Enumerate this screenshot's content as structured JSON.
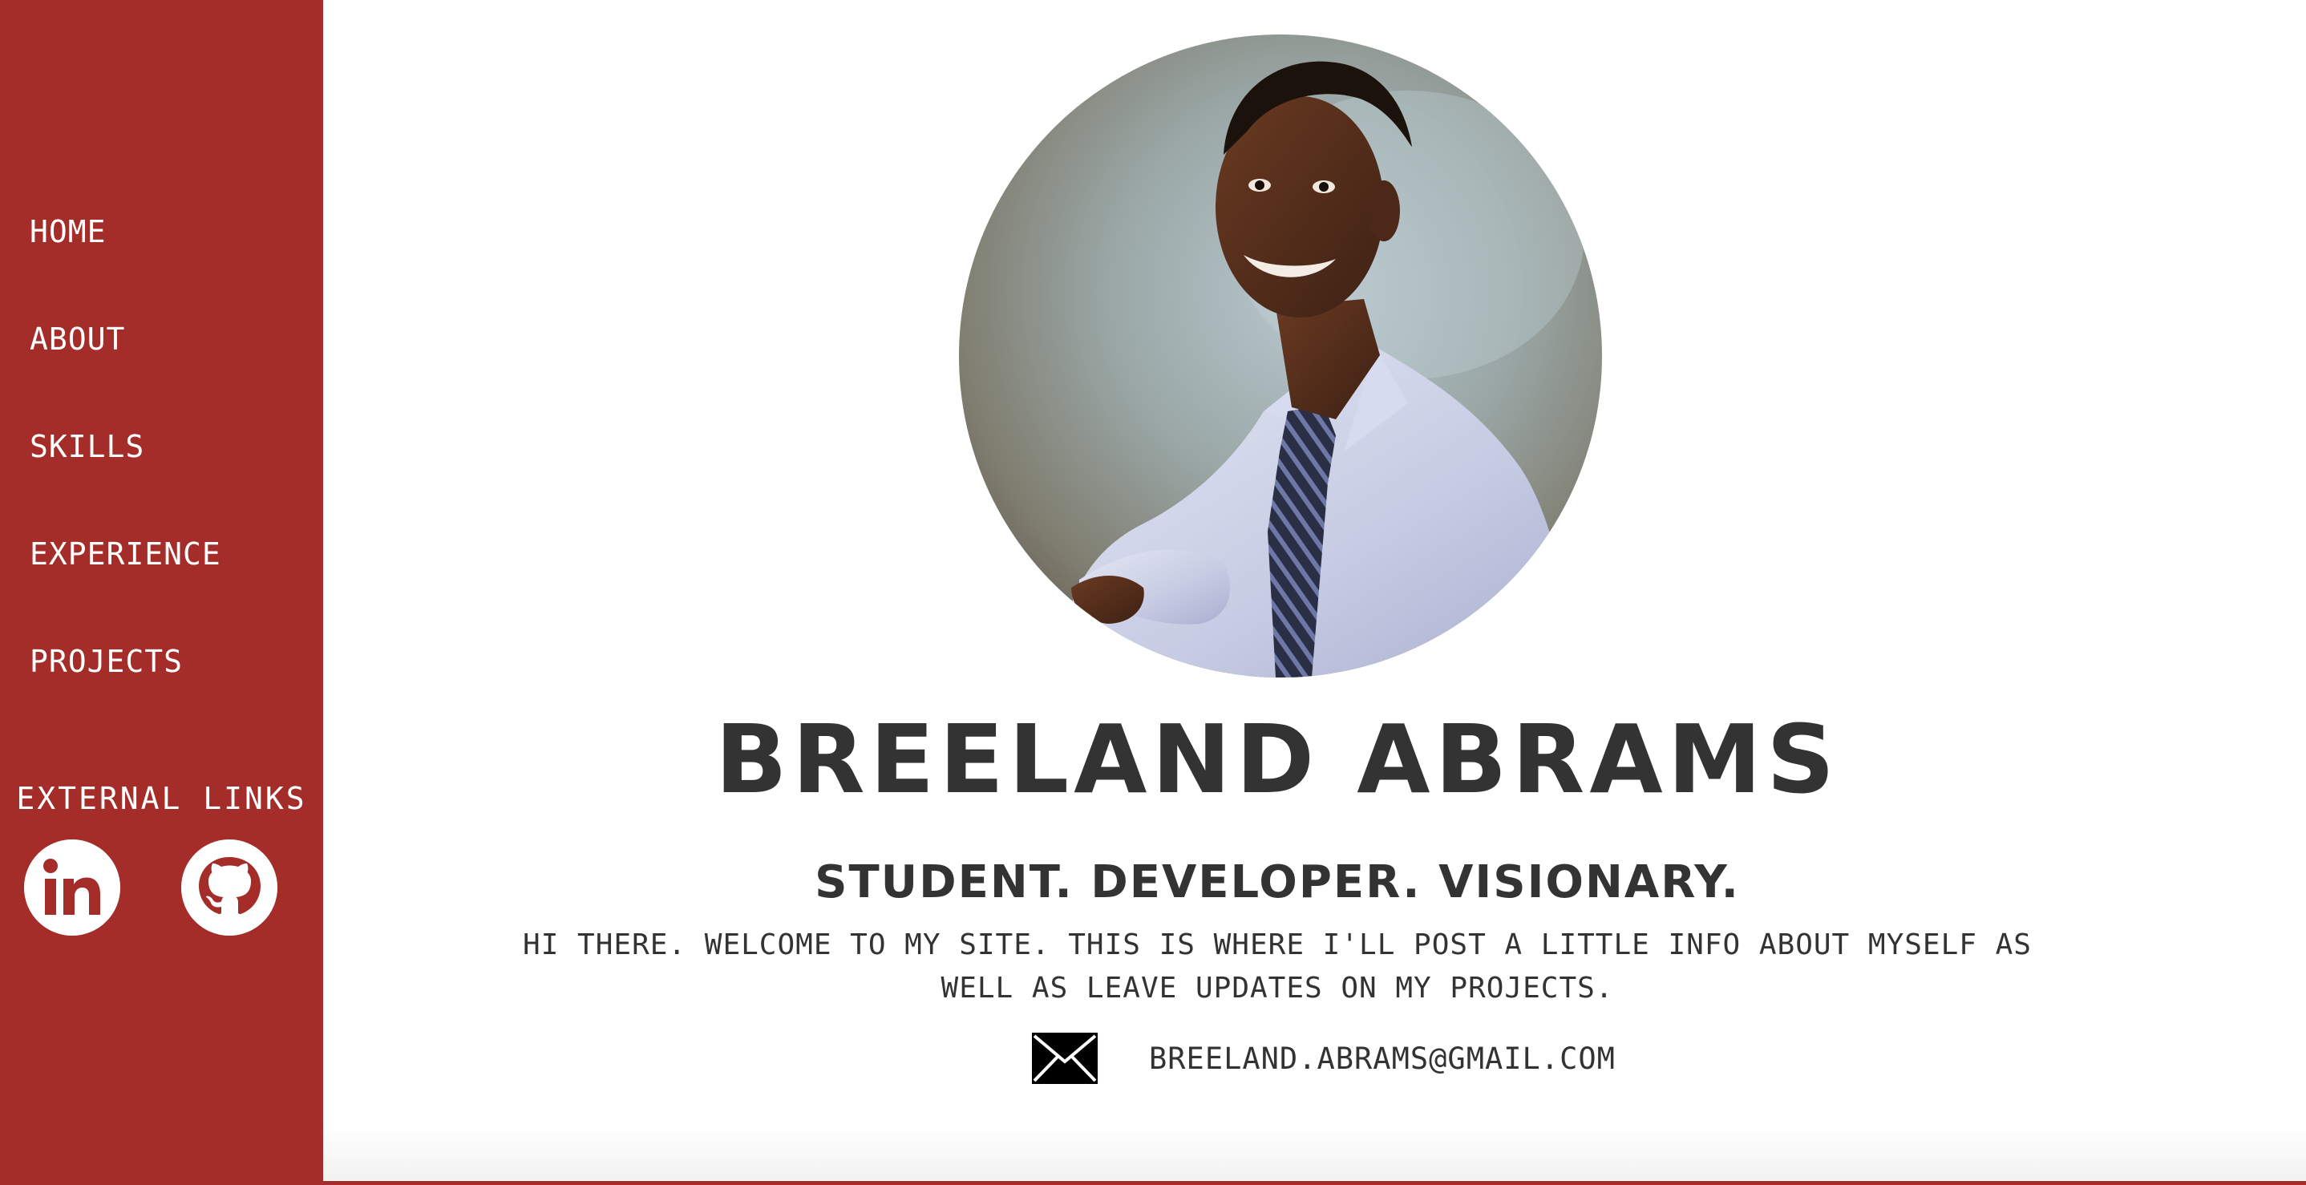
{
  "theme": {
    "accent": "#a52d29",
    "text": "#333333",
    "background": "#ffffff"
  },
  "sidebar": {
    "nav": [
      {
        "label": "HOME"
      },
      {
        "label": "ABOUT"
      },
      {
        "label": "SKILLS"
      },
      {
        "label": "EXPERIENCE"
      },
      {
        "label": "PROJECTS"
      }
    ],
    "external_links_title": "EXTERNAL LINKS",
    "external_links": [
      {
        "icon": "linkedin-icon"
      },
      {
        "icon": "github-icon"
      }
    ]
  },
  "hero": {
    "portrait_icon": "profile-photo",
    "name": "BREELAND ABRAMS",
    "tagline": "STUDENT. DEVELOPER. VISIONARY.",
    "intro": "HI THERE. WELCOME TO MY SITE. THIS IS WHERE I'LL POST A LITTLE INFO ABOUT MYSELF AS WELL AS LEAVE UPDATES ON MY PROJECTS.",
    "contact": {
      "icon": "envelope-icon",
      "email": "BREELAND.ABRAMS@GMAIL.COM"
    }
  }
}
